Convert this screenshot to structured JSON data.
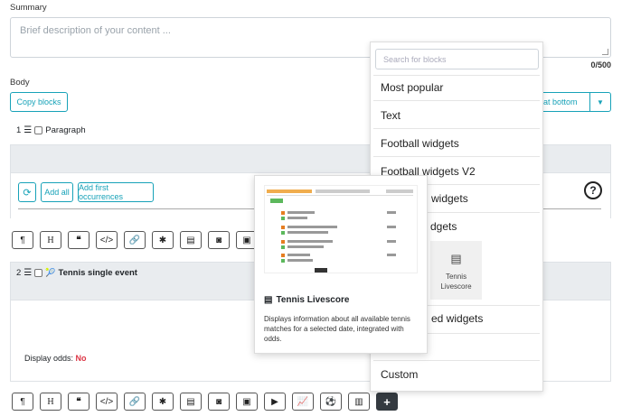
{
  "summary": {
    "label": "Summary",
    "placeholder": "Brief description of your content ...",
    "counter": "0/500"
  },
  "body": {
    "label": "Body",
    "copy_blocks": "Copy blocks",
    "insert_at_bottom": "at bottom"
  },
  "block1": {
    "number": "1",
    "type": "Paragraph"
  },
  "actions": {
    "add_all": "Add all",
    "add_first": "Add first occurrences"
  },
  "block2": {
    "number": "2",
    "title": "Tennis single event",
    "display_odds_label": "Display odds:",
    "display_odds_value": "No"
  },
  "dropdown": {
    "search_placeholder": "Search for blocks",
    "items": [
      "Most popular",
      "Text",
      "Football widgets",
      "Football widgets V2",
      "widgets",
      "dgets",
      "ed widgets",
      "Custom"
    ],
    "tile_label": "Tennis Livescore"
  },
  "popup": {
    "title": "Tennis Livescore",
    "description": "Displays information about all available tennis matches for a selected date, integrated with odds."
  },
  "toolbar_icons": [
    "paragraph-icon",
    "heading-icon",
    "quote-icon",
    "code-icon",
    "link-icon",
    "asterisk-icon",
    "document-icon",
    "camera-icon",
    "image-icon"
  ],
  "toolbar2_icons": [
    "paragraph-icon",
    "heading-icon",
    "quote-icon",
    "code-icon",
    "link-icon",
    "asterisk-icon",
    "document-icon",
    "camera-icon",
    "image-icon",
    "play-icon",
    "line-chart-icon",
    "football-icon",
    "bar-chart-icon",
    "plus-icon"
  ],
  "colors": {
    "accent": "#17a2b8",
    "danger": "#dc3545",
    "dark": "#343a40"
  }
}
